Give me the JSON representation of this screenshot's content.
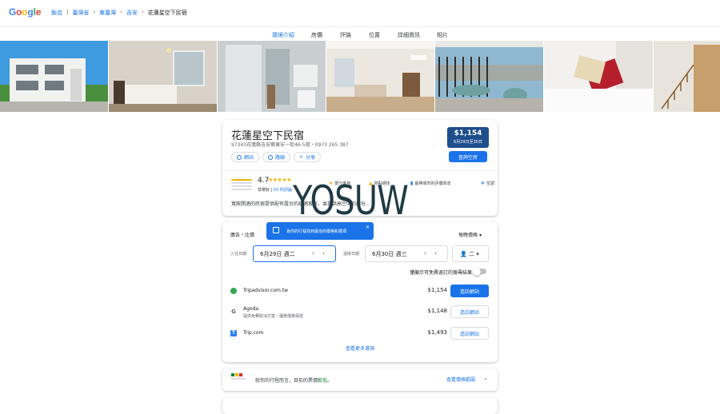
{
  "header": {
    "logo": "Google",
    "logo_colors": [
      "#4285F4",
      "#EA4335",
      "#FBBC05",
      "#4285F4",
      "#34A853",
      "#EA4335"
    ],
    "breadcrumbs": [
      "飯店",
      "臺灣省",
      "東臺灣",
      "吉安",
      "花蓮星空下民宿"
    ]
  },
  "tabs": [
    "環境介紹",
    "房價",
    "評論",
    "位置",
    "詳細資訊",
    "相片"
  ],
  "hotel": {
    "name": "花蓮星空下民宿",
    "address": "97343花蓮縣吉安鄉東安一街46-5號・0973 265 387",
    "chips": [
      "網站",
      "路線",
      "分享"
    ],
    "price": "$1,154",
    "price_dates": "6月29日至30日",
    "check_button": "查詢空房",
    "rating": "4.7",
    "rating_label": "非常好",
    "review_count": "50 則評論",
    "amenities": [
      "部分客房",
      "地點絕佳",
      "最棒城市的評價高達",
      "空調"
    ],
    "description": "寬敞開適的民宿提供配有露台的舒適客房，並提供高空中的部份..."
  },
  "watermark": "YOSUW",
  "prices": {
    "section_label": "廣告・比價",
    "tooltip": "為你的行程找到最佳的價格和選項",
    "nightly": "每晚價格",
    "checkin_label": "入住日期",
    "checkin": "6月29日 週二",
    "checkout_label": "退房日期",
    "checkout": "6月30日 週三",
    "guests": "二",
    "free_cancel": "僅顯示可免費退訂的搜尋結果",
    "providers": [
      {
        "name": "Tripadvisor.com.tw",
        "sub": "",
        "price": "$1,154",
        "btn": "造訪網站",
        "color": "#34A853"
      },
      {
        "name": "Agoda",
        "sub": "提供免費取消方案・優惠價格保證",
        "price": "$1,148",
        "btn": "造訪網站",
        "color": "#5f6368"
      },
      {
        "name": "Trip.com",
        "sub": "",
        "price": "$1,493",
        "btn": "造訪網站",
        "color": "#287DFA"
      }
    ],
    "more": "查看更多選項"
  },
  "trip": {
    "message_prefix": "就你的行程而言，目前的票價",
    "message_highlight": "較低",
    "message_suffix": "。",
    "range_link": "查看價格範圍"
  }
}
